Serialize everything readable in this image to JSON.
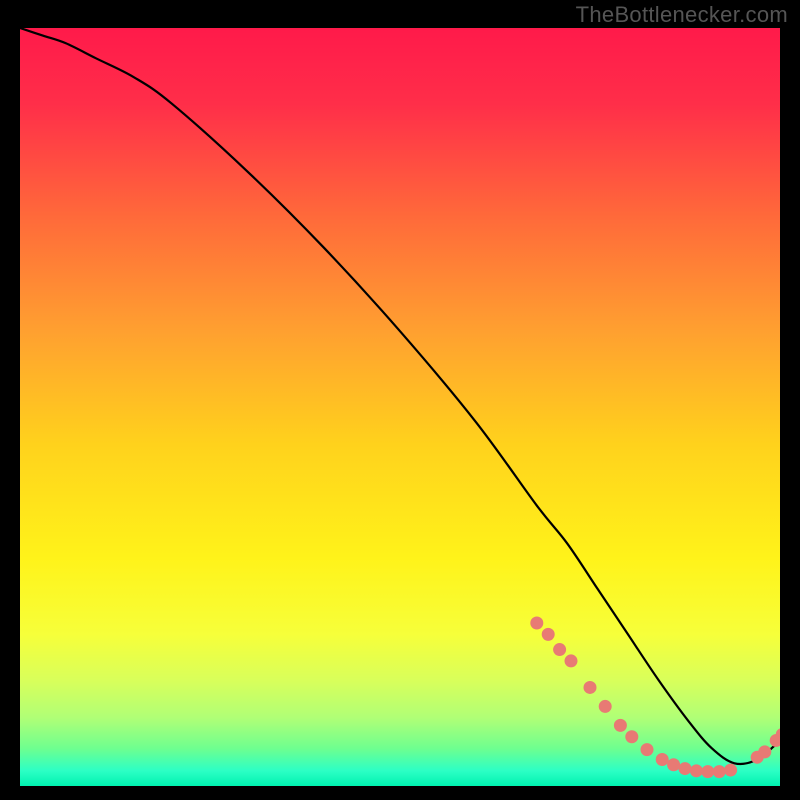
{
  "watermark": "TheBottlenecker.com",
  "colors": {
    "bg": "#000000",
    "gradient_stops": [
      {
        "offset": 0.0,
        "color": "#ff1a4a"
      },
      {
        "offset": 0.1,
        "color": "#ff2e49"
      },
      {
        "offset": 0.25,
        "color": "#ff6a3a"
      },
      {
        "offset": 0.4,
        "color": "#ffa030"
      },
      {
        "offset": 0.55,
        "color": "#ffd21c"
      },
      {
        "offset": 0.7,
        "color": "#fff31a"
      },
      {
        "offset": 0.8,
        "color": "#f6ff3a"
      },
      {
        "offset": 0.86,
        "color": "#d9ff5a"
      },
      {
        "offset": 0.91,
        "color": "#b0ff76"
      },
      {
        "offset": 0.95,
        "color": "#6fff8f"
      },
      {
        "offset": 0.98,
        "color": "#2cffc5"
      },
      {
        "offset": 1.0,
        "color": "#00f2b0"
      }
    ],
    "curve": "#000000",
    "marker": "#e87a74"
  },
  "chart_data": {
    "type": "line",
    "title": "",
    "xlabel": "",
    "ylabel": "",
    "xlim": [
      0,
      100
    ],
    "ylim": [
      0,
      100
    ],
    "series": [
      {
        "name": "curve",
        "x": [
          0,
          3,
          6,
          10,
          15,
          20,
          30,
          40,
          50,
          60,
          68,
          72,
          76,
          80,
          84,
          88,
          91,
          94,
          97,
          100
        ],
        "y": [
          100,
          99,
          98,
          96,
          93.5,
          90,
          81,
          71,
          60,
          48,
          37,
          32,
          26,
          20,
          14,
          8.5,
          5,
          3,
          3.5,
          6
        ]
      }
    ],
    "markers": [
      {
        "x": 68.0,
        "y": 21.5
      },
      {
        "x": 69.5,
        "y": 20.0
      },
      {
        "x": 71.0,
        "y": 18.0
      },
      {
        "x": 72.5,
        "y": 16.5
      },
      {
        "x": 75.0,
        "y": 13.0
      },
      {
        "x": 77.0,
        "y": 10.5
      },
      {
        "x": 79.0,
        "y": 8.0
      },
      {
        "x": 80.5,
        "y": 6.5
      },
      {
        "x": 82.5,
        "y": 4.8
      },
      {
        "x": 84.5,
        "y": 3.5
      },
      {
        "x": 86.0,
        "y": 2.8
      },
      {
        "x": 87.5,
        "y": 2.3
      },
      {
        "x": 89.0,
        "y": 2.0
      },
      {
        "x": 90.5,
        "y": 1.9
      },
      {
        "x": 92.0,
        "y": 1.9
      },
      {
        "x": 93.5,
        "y": 2.1
      },
      {
        "x": 97.0,
        "y": 3.8
      },
      {
        "x": 98.0,
        "y": 4.5
      },
      {
        "x": 99.5,
        "y": 6.0
      },
      {
        "x": 100.3,
        "y": 6.8
      }
    ]
  }
}
